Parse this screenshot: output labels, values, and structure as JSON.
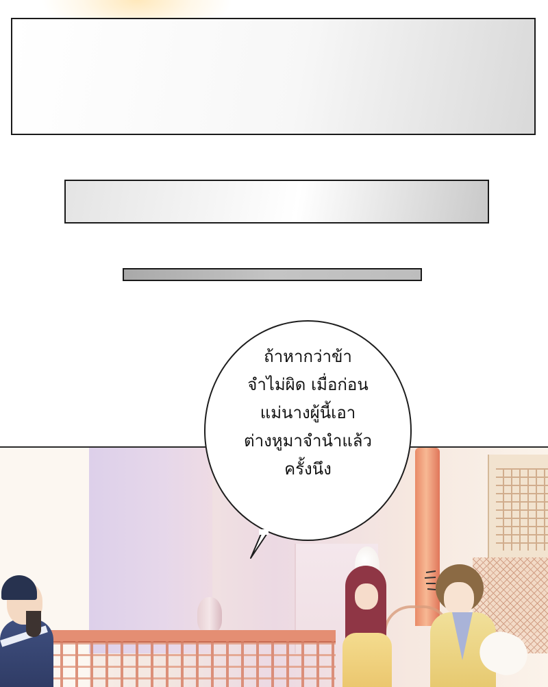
{
  "speech_bubble": {
    "lines": [
      "ถ้าหากว่าข้า",
      "จำไม่ผิด เมื่อก่อน",
      "แม่นางผู้นี้เอา",
      "ต่างหูมาจำนำแล้ว",
      "ครั้งนึง"
    ]
  },
  "colors": {
    "panel_border": "#1a1a1a",
    "pillar": "#e98a67",
    "curtain": "#ddd0ea",
    "table": "#e48e73"
  }
}
